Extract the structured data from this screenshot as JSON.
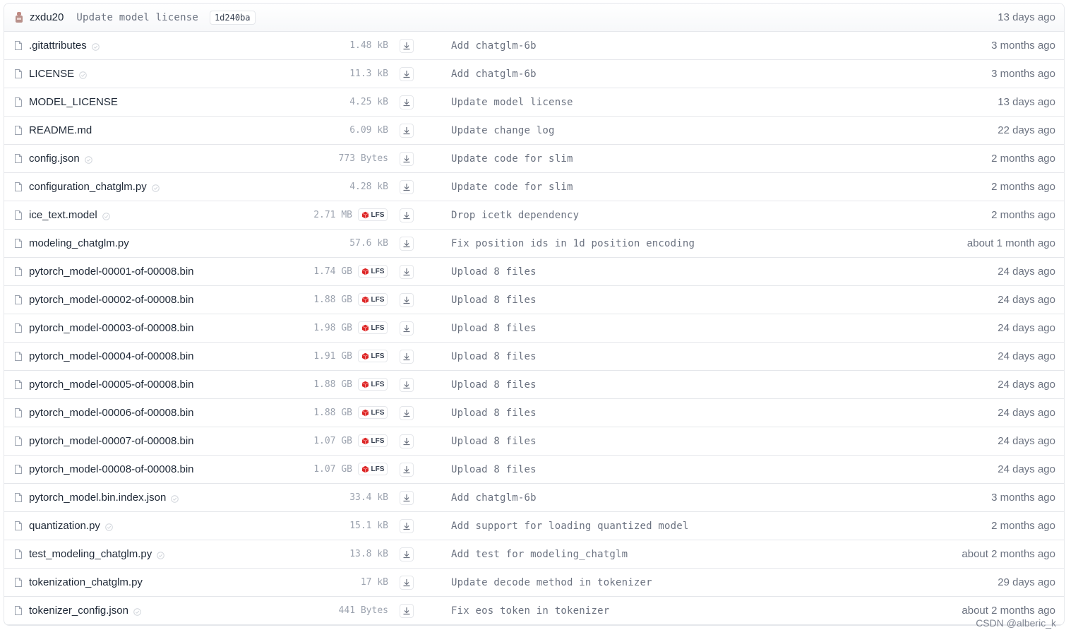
{
  "commit": {
    "author": "zxdu20",
    "message": "Update model license",
    "sha": "1d240ba",
    "date": "13 days ago"
  },
  "files": [
    {
      "name": ".gitattributes",
      "safe": true,
      "size": "1.48 kB",
      "lfs": false,
      "message": "Add chatglm-6b",
      "date": "3 months ago"
    },
    {
      "name": "LICENSE",
      "safe": true,
      "size": "11.3 kB",
      "lfs": false,
      "message": "Add chatglm-6b",
      "date": "3 months ago"
    },
    {
      "name": "MODEL_LICENSE",
      "safe": false,
      "size": "4.25 kB",
      "lfs": false,
      "message": "Update model license",
      "date": "13 days ago"
    },
    {
      "name": "README.md",
      "safe": false,
      "size": "6.09 kB",
      "lfs": false,
      "message": "Update change log",
      "date": "22 days ago"
    },
    {
      "name": "config.json",
      "safe": true,
      "size": "773 Bytes",
      "lfs": false,
      "message": "Update code for slim",
      "date": "2 months ago"
    },
    {
      "name": "configuration_chatglm.py",
      "safe": true,
      "size": "4.28 kB",
      "lfs": false,
      "message": "Update code for slim",
      "date": "2 months ago"
    },
    {
      "name": "ice_text.model",
      "safe": true,
      "size": "2.71 MB",
      "lfs": true,
      "message": "Drop icetk dependency",
      "date": "2 months ago"
    },
    {
      "name": "modeling_chatglm.py",
      "safe": false,
      "size": "57.6 kB",
      "lfs": false,
      "message": "Fix position ids in 1d position encoding",
      "date": "about 1 month ago"
    },
    {
      "name": "pytorch_model-00001-of-00008.bin",
      "safe": false,
      "size": "1.74 GB",
      "lfs": true,
      "message": "Upload 8 files",
      "date": "24 days ago"
    },
    {
      "name": "pytorch_model-00002-of-00008.bin",
      "safe": false,
      "size": "1.88 GB",
      "lfs": true,
      "message": "Upload 8 files",
      "date": "24 days ago"
    },
    {
      "name": "pytorch_model-00003-of-00008.bin",
      "safe": false,
      "size": "1.98 GB",
      "lfs": true,
      "message": "Upload 8 files",
      "date": "24 days ago"
    },
    {
      "name": "pytorch_model-00004-of-00008.bin",
      "safe": false,
      "size": "1.91 GB",
      "lfs": true,
      "message": "Upload 8 files",
      "date": "24 days ago"
    },
    {
      "name": "pytorch_model-00005-of-00008.bin",
      "safe": false,
      "size": "1.88 GB",
      "lfs": true,
      "message": "Upload 8 files",
      "date": "24 days ago"
    },
    {
      "name": "pytorch_model-00006-of-00008.bin",
      "safe": false,
      "size": "1.88 GB",
      "lfs": true,
      "message": "Upload 8 files",
      "date": "24 days ago"
    },
    {
      "name": "pytorch_model-00007-of-00008.bin",
      "safe": false,
      "size": "1.07 GB",
      "lfs": true,
      "message": "Upload 8 files",
      "date": "24 days ago"
    },
    {
      "name": "pytorch_model-00008-of-00008.bin",
      "safe": false,
      "size": "1.07 GB",
      "lfs": true,
      "message": "Upload 8 files",
      "date": "24 days ago"
    },
    {
      "name": "pytorch_model.bin.index.json",
      "safe": true,
      "size": "33.4 kB",
      "lfs": false,
      "message": "Add chatglm-6b",
      "date": "3 months ago"
    },
    {
      "name": "quantization.py",
      "safe": true,
      "size": "15.1 kB",
      "lfs": false,
      "message": "Add support for loading quantized model",
      "date": "2 months ago"
    },
    {
      "name": "test_modeling_chatglm.py",
      "safe": true,
      "size": "13.8 kB",
      "lfs": false,
      "message": "Add test for modeling_chatglm",
      "date": "about 2 months ago"
    },
    {
      "name": "tokenization_chatglm.py",
      "safe": false,
      "size": "17 kB",
      "lfs": false,
      "message": "Update decode method in tokenizer",
      "date": "29 days ago"
    },
    {
      "name": "tokenizer_config.json",
      "safe": true,
      "size": "441 Bytes",
      "lfs": false,
      "message": "Fix eos token in tokenizer",
      "date": "about 2 months ago"
    }
  ],
  "lfs_label": "LFS",
  "watermark": "CSDN @alberic_k",
  "icons": {
    "file": "file-icon",
    "safe": "safe-check-icon",
    "lfs": "lfs-cube-icon",
    "download": "download-icon",
    "avatar": "avatar-icon"
  },
  "colors": {
    "lfs_cube": "#dc2626",
    "border": "#e5e7eb",
    "muted_text": "#6b7280"
  }
}
